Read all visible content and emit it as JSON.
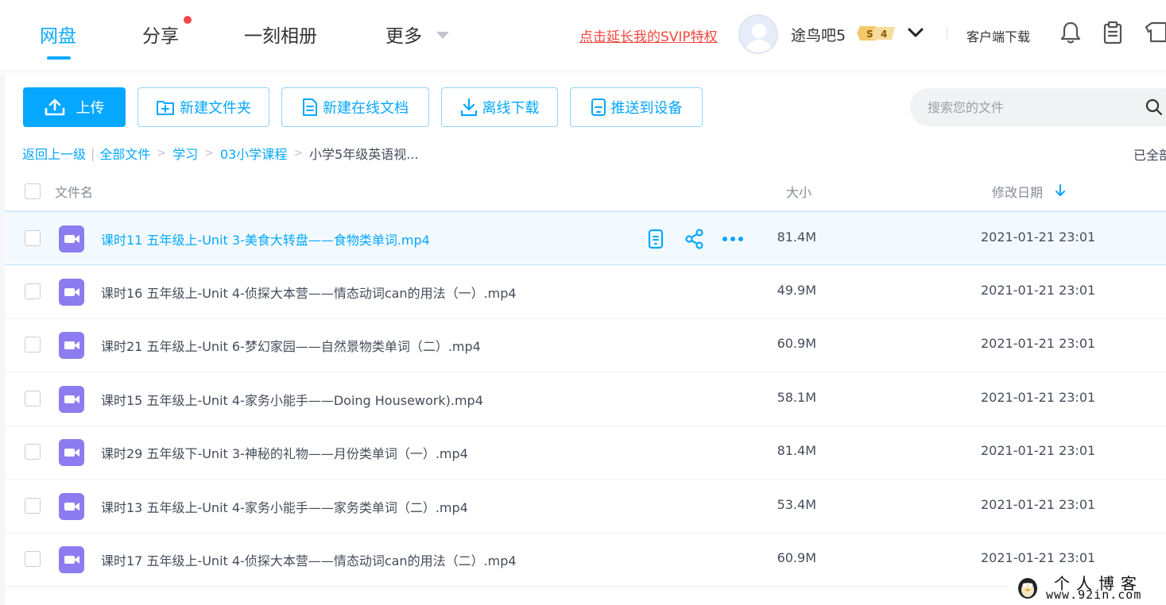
{
  "nav": {
    "items": [
      {
        "label": "网盘",
        "active": true
      },
      {
        "label": "分享",
        "active": false,
        "has_dot": true
      },
      {
        "label": "一刻相册",
        "active": false
      },
      {
        "label": "更多",
        "active": false,
        "dropdown": true
      }
    ]
  },
  "header": {
    "svip_link": "点击延长我的SVIP特权",
    "username": "途鸟吧5",
    "vip_badge": {
      "left": "S",
      "right": "4"
    },
    "client_download": "客户端下载",
    "icons": [
      "bell-icon",
      "clipboard-icon",
      "tshirt-icon"
    ]
  },
  "toolbar": {
    "upload": "上传",
    "new_folder": "新建文件夹",
    "new_doc": "新建在线文档",
    "offline_download": "离线下载",
    "push_device": "推送到设备"
  },
  "search": {
    "placeholder": "搜索您的文件",
    "value": ""
  },
  "breadcrumb": {
    "back": "返回上一级",
    "items": [
      "全部文件",
      "学习",
      "03小学课程"
    ],
    "current": "小学5年级英语视...",
    "separator": ">"
  },
  "loaded_label": "已全部",
  "table": {
    "headers": {
      "name": "文件名",
      "size": "大小",
      "date": "修改日期"
    },
    "sort": {
      "column": "date",
      "direction": "desc"
    },
    "rows": [
      {
        "name": "课时11 五年级上-Unit 3-美食大转盘——食物类单词.mp4",
        "size": "81.4M",
        "date": "2021-01-21 23:01",
        "hover": true
      },
      {
        "name": "课时16 五年级上-Unit 4-侦探大本营——情态动词can的用法（一）.mp4",
        "size": "49.9M",
        "date": "2021-01-21 23:01"
      },
      {
        "name": "课时21 五年级上-Unit 6-梦幻家园——自然景物类单词（二）.mp4",
        "size": "60.9M",
        "date": "2021-01-21 23:01"
      },
      {
        "name": "课时15 五年级上-Unit 4-家务小能手——Doing Housework).mp4",
        "size": "58.1M",
        "date": "2021-01-21 23:01"
      },
      {
        "name": "课时29 五年级下-Unit 3-神秘的礼物——月份类单词（一）.mp4",
        "size": "81.4M",
        "date": "2021-01-21 23:01"
      },
      {
        "name": "课时13 五年级上-Unit 4-家务小能手——家务类单词（二）.mp4",
        "size": "53.4M",
        "date": "2021-01-21 23:01"
      },
      {
        "name": "课时17 五年级上-Unit 4-侦探大本营——情态动词can的用法（二）.mp4",
        "size": "60.9M",
        "date": "2021-01-21 23:01"
      }
    ]
  },
  "watermark": {
    "title": "个人博客",
    "url": "www.92in.com"
  },
  "colors": {
    "accent": "#06a7ff",
    "svip_red": "#f0483e",
    "video_icon": "#8d7cf0",
    "hover_row": "#f3faff"
  }
}
